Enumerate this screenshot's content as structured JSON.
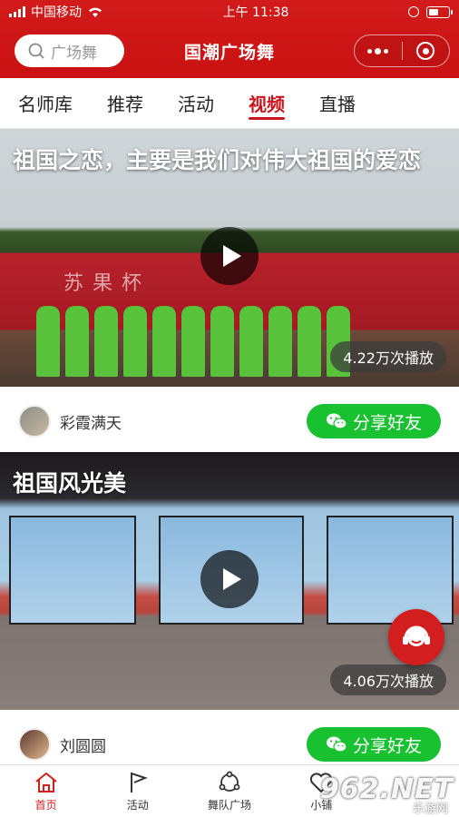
{
  "status_bar": {
    "carrier": "中国移动",
    "time": "上午 11:38"
  },
  "header": {
    "search_placeholder": "广场舞",
    "title": "国潮广场舞"
  },
  "tabs": [
    {
      "label": "名师库",
      "active": false
    },
    {
      "label": "推荐",
      "active": false
    },
    {
      "label": "活动",
      "active": false
    },
    {
      "label": "视频",
      "active": true
    },
    {
      "label": "直播",
      "active": false
    }
  ],
  "videos": [
    {
      "title": "祖国之恋，主要是我们对伟大祖国的爱恋",
      "views": "4.22万次播放",
      "author": "彩霞满天",
      "share_label": "分享好友",
      "banner_text": "苏果杯"
    },
    {
      "title": "祖国风光美",
      "views": "4.06万次播放",
      "author": "刘圆圆",
      "share_label": "分享好友"
    }
  ],
  "bottom_nav": [
    {
      "label": "首页",
      "icon": "home-icon",
      "active": true
    },
    {
      "label": "活动",
      "icon": "flag-icon",
      "active": false
    },
    {
      "label": "舞队广场",
      "icon": "team-icon",
      "active": false
    },
    {
      "label": "小铺",
      "icon": "heart-icon",
      "active": false
    }
  ],
  "watermark": {
    "logo": "962.NET",
    "subtitle": "乐游网"
  },
  "colors": {
    "brand_red": "#c9151e",
    "share_green": "#18c12f"
  }
}
